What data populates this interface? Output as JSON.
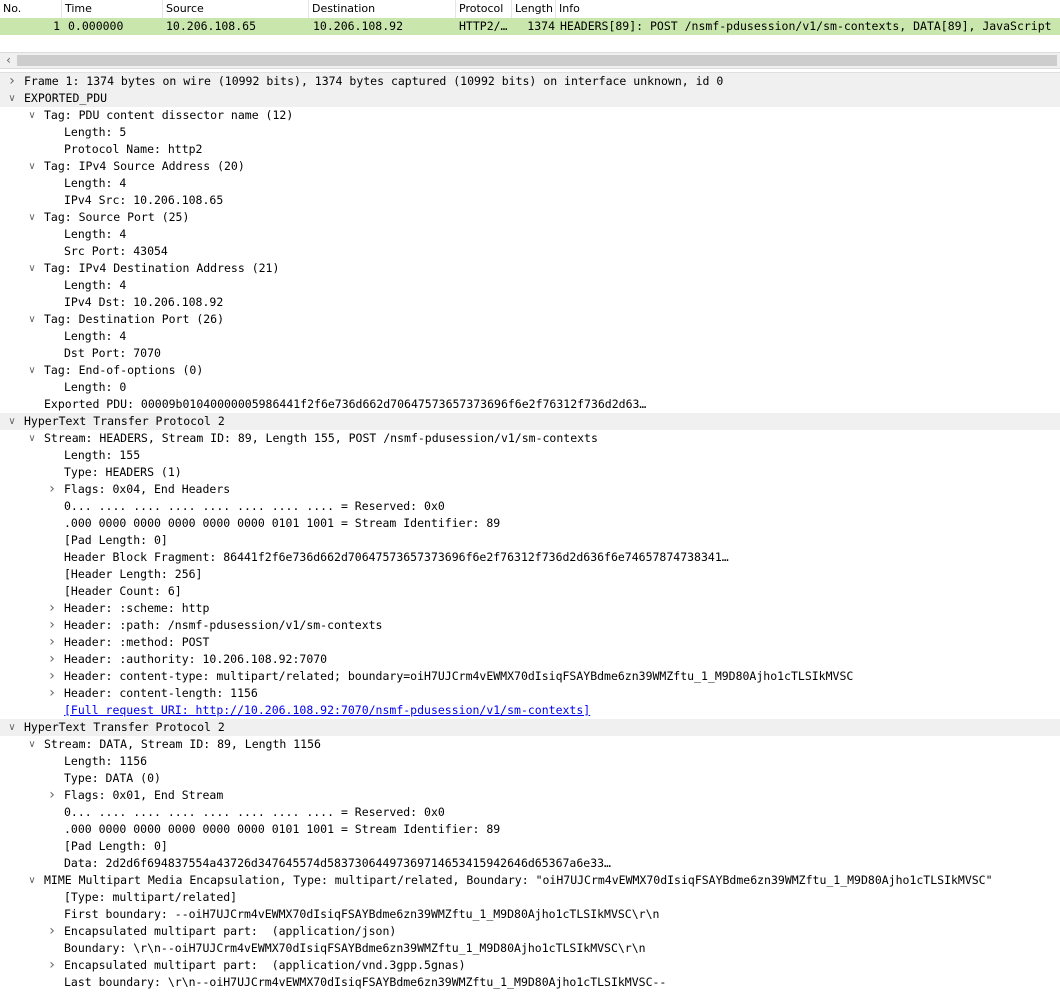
{
  "packet_list": {
    "columns": [
      "No.",
      "Time",
      "Source",
      "Destination",
      "Protocol",
      "Length",
      "Info"
    ],
    "row": {
      "no": "1",
      "time": "0.000000",
      "source": "10.206.108.65",
      "destination": "10.206.108.92",
      "protocol": "HTTP2/…",
      "length": "1374",
      "info": "HEADERS[89]: POST /nsmf-pdusession/v1/sm-contexts, DATA[89], JavaScript"
    },
    "row_color": "#c9e6ad"
  },
  "scrollbar": {
    "left_arrow_icon": "chevron-left-icon"
  },
  "details": {
    "rows": [
      {
        "arrow": "collapsed",
        "text": "Frame 1: 1374 bytes on wire (10992 bits), 1374 bytes captured (10992 bits) on interface unknown, id 0"
      },
      {
        "arrow": "expanded",
        "text": "EXPORTED_PDU"
      },
      {
        "arrow": "expanded",
        "text": "Tag: PDU content dissector name (12)"
      },
      {
        "arrow": "none",
        "text": "Length: 5"
      },
      {
        "arrow": "none",
        "text": "Protocol Name: http2"
      },
      {
        "arrow": "expanded",
        "text": "Tag: IPv4 Source Address (20)"
      },
      {
        "arrow": "none",
        "text": "Length: 4"
      },
      {
        "arrow": "none",
        "text": "IPv4 Src: 10.206.108.65"
      },
      {
        "arrow": "expanded",
        "text": "Tag: Source Port (25)"
      },
      {
        "arrow": "none",
        "text": "Length: 4"
      },
      {
        "arrow": "none",
        "text": "Src Port: 43054"
      },
      {
        "arrow": "expanded",
        "text": "Tag: IPv4 Destination Address (21)"
      },
      {
        "arrow": "none",
        "text": "Length: 4"
      },
      {
        "arrow": "none",
        "text": "IPv4 Dst: 10.206.108.92"
      },
      {
        "arrow": "expanded",
        "text": "Tag: Destination Port (26)"
      },
      {
        "arrow": "none",
        "text": "Length: 4"
      },
      {
        "arrow": "none",
        "text": "Dst Port: 7070"
      },
      {
        "arrow": "expanded",
        "text": "Tag: End-of-options (0)"
      },
      {
        "arrow": "none",
        "text": "Length: 0"
      },
      {
        "arrow": "none",
        "text": "Exported PDU: 00009b01040000005986441f2f6e736d662d70647573657373696f6e2f76312f736d2d63…"
      },
      {
        "arrow": "expanded",
        "text": "HyperText Transfer Protocol 2"
      },
      {
        "arrow": "expanded",
        "text": "Stream: HEADERS, Stream ID: 89, Length 155, POST /nsmf-pdusession/v1/sm-contexts"
      },
      {
        "arrow": "none",
        "text": "Length: 155"
      },
      {
        "arrow": "none",
        "text": "Type: HEADERS (1)"
      },
      {
        "arrow": "collapsed",
        "text": "Flags: 0x04, End Headers"
      },
      {
        "arrow": "none",
        "text": "0... .... .... .... .... .... .... .... = Reserved: 0x0"
      },
      {
        "arrow": "none",
        "text": ".000 0000 0000 0000 0000 0000 0101 1001 = Stream Identifier: 89"
      },
      {
        "arrow": "none",
        "text": "[Pad Length: 0]"
      },
      {
        "arrow": "none",
        "text": "Header Block Fragment: 86441f2f6e736d662d70647573657373696f6e2f76312f736d2d636f6e74657874738341…"
      },
      {
        "arrow": "none",
        "text": "[Header Length: 256]"
      },
      {
        "arrow": "none",
        "text": "[Header Count: 6]"
      },
      {
        "arrow": "collapsed",
        "text": "Header: :scheme: http"
      },
      {
        "arrow": "collapsed",
        "text": "Header: :path: /nsmf-pdusession/v1/sm-contexts"
      },
      {
        "arrow": "collapsed",
        "text": "Header: :method: POST"
      },
      {
        "arrow": "collapsed",
        "text": "Header: :authority: 10.206.108.92:7070"
      },
      {
        "arrow": "collapsed",
        "text": "Header: content-type: multipart/related; boundary=oiH7UJCrm4vEWMX70dIsiqFSAYBdme6zn39WMZftu_1_M9D80Ajho1cTLSIkMVSC"
      },
      {
        "arrow": "collapsed",
        "text": "Header: content-length: 1156"
      },
      {
        "arrow": "none",
        "link": true,
        "text": "[Full request URI: http://10.206.108.92:7070/nsmf-pdusession/v1/sm-contexts]"
      },
      {
        "arrow": "expanded",
        "text": "HyperText Transfer Protocol 2"
      },
      {
        "arrow": "expanded",
        "text": "Stream: DATA, Stream ID: 89, Length 1156"
      },
      {
        "arrow": "none",
        "text": "Length: 1156"
      },
      {
        "arrow": "none",
        "text": "Type: DATA (0)"
      },
      {
        "arrow": "collapsed",
        "text": "Flags: 0x01, End Stream"
      },
      {
        "arrow": "none",
        "text": "0... .... .... .... .... .... .... .... = Reserved: 0x0"
      },
      {
        "arrow": "none",
        "text": ".000 0000 0000 0000 0000 0000 0101 1001 = Stream Identifier: 89"
      },
      {
        "arrow": "none",
        "text": "[Pad Length: 0]"
      },
      {
        "arrow": "none",
        "text": "Data: 2d2d6f694837554a43726d347645574d58373064497369714653415942646d65367a6e33…"
      },
      {
        "arrow": "expanded",
        "text": "MIME Multipart Media Encapsulation, Type: multipart/related, Boundary: \"oiH7UJCrm4vEWMX70dIsiqFSAYBdme6zn39WMZftu_1_M9D80Ajho1cTLSIkMVSC\""
      },
      {
        "arrow": "none",
        "text": "[Type: multipart/related]"
      },
      {
        "arrow": "none",
        "text": "First boundary: --oiH7UJCrm4vEWMX70dIsiqFSAYBdme6zn39WMZftu_1_M9D80Ajho1cTLSIkMVSC\\r\\n"
      },
      {
        "arrow": "collapsed",
        "text": "Encapsulated multipart part:  (application/json)"
      },
      {
        "arrow": "none",
        "text": "Boundary: \\r\\n--oiH7UJCrm4vEWMX70dIsiqFSAYBdme6zn39WMZftu_1_M9D80Ajho1cTLSIkMVSC\\r\\n"
      },
      {
        "arrow": "collapsed",
        "text": "Encapsulated multipart part:  (application/vnd.3gpp.5gnas)"
      },
      {
        "arrow": "none",
        "text": "Last boundary: \\r\\n--oiH7UJCrm4vEWMX70dIsiqFSAYBdme6zn39WMZftu_1_M9D80Ajho1cTLSIkMVSC--"
      }
    ]
  }
}
